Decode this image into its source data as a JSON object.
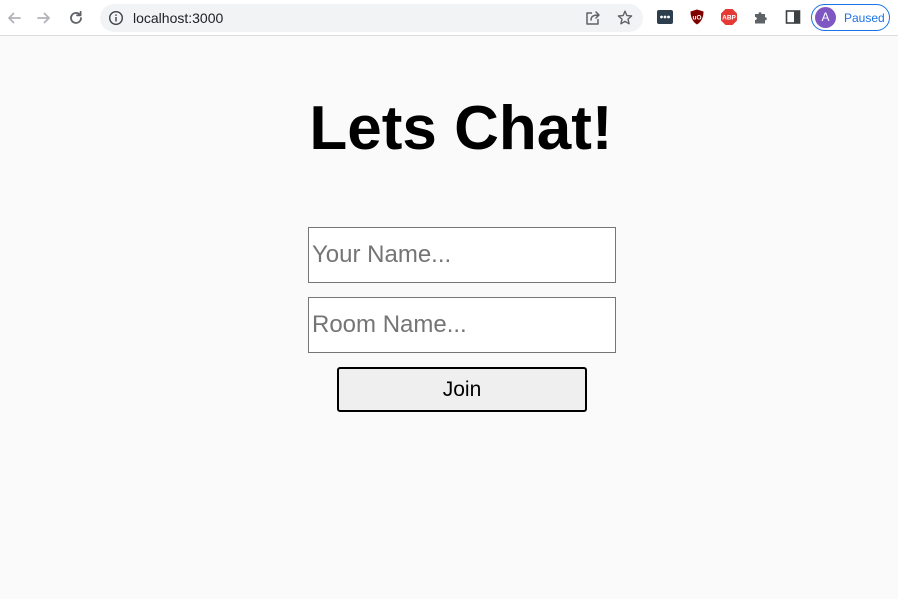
{
  "browser": {
    "url": "localhost:3000",
    "profile": {
      "initial": "A",
      "status": "Paused",
      "avatar_color": "#7e57c2",
      "accent_color": "#1a73e8"
    },
    "icons": {
      "back": "back-arrow-icon",
      "forward": "forward-arrow-icon",
      "reload": "reload-icon",
      "site_info": "info-icon",
      "share": "share-icon",
      "bookmark": "star-icon",
      "extension_1": "password-manager-icon",
      "extension_2": "ublock-origin-icon",
      "extension_3": "adblock-plus-icon",
      "extensions_menu": "puzzle-icon",
      "side_panel": "side-panel-icon"
    },
    "extension_labels": {
      "ublock": "uO",
      "abp": "ABP"
    }
  },
  "page": {
    "title": "Lets Chat!",
    "name_input": {
      "placeholder": "Your Name...",
      "value": ""
    },
    "room_input": {
      "placeholder": "Room Name...",
      "value": ""
    },
    "join_button": {
      "label": "Join"
    },
    "background_color": "#fafafa"
  }
}
